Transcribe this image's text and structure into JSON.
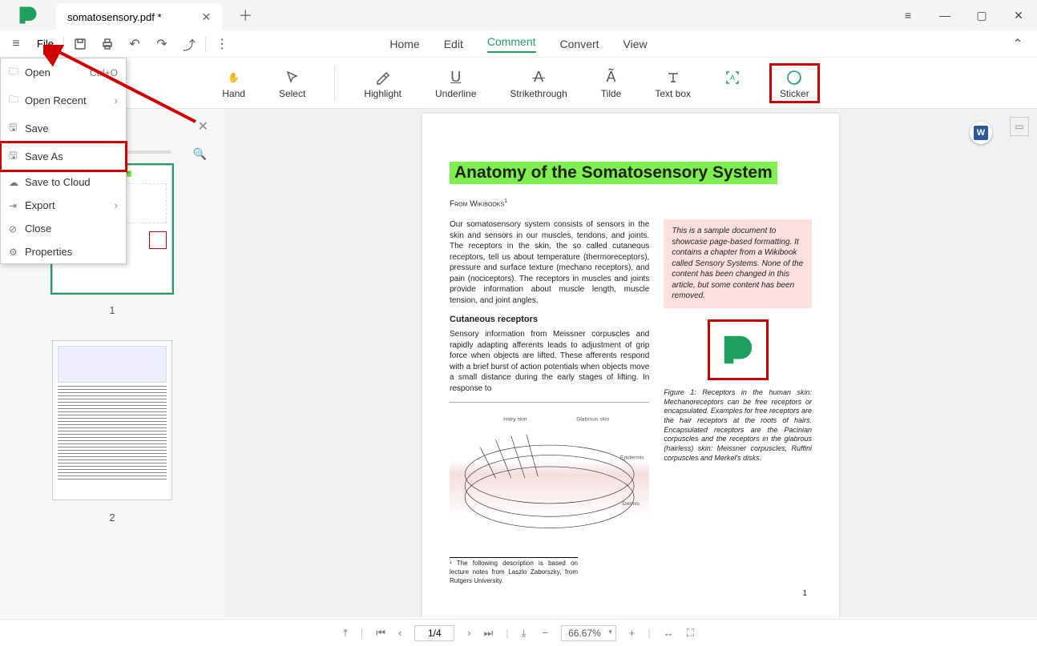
{
  "tab": {
    "title": "somatosensory.pdf *"
  },
  "file_label": "File",
  "ribbon_tabs": {
    "home": "Home",
    "edit": "Edit",
    "comment": "Comment",
    "convert": "Convert",
    "view": "View"
  },
  "tools": {
    "hand": "Hand",
    "select": "Select",
    "highlight": "Highlight",
    "underline": "Underline",
    "strikethrough": "Strikethrough",
    "tilde": "Tilde",
    "textbox": "Text box",
    "sticker": "Sticker"
  },
  "file_menu": {
    "open": {
      "label": "Open",
      "shortcut": "Ctrl+O"
    },
    "open_recent": {
      "label": "Open Recent"
    },
    "save": {
      "label": "Save"
    },
    "save_as": {
      "label": "Save As"
    },
    "save_cloud": {
      "label": "Save to Cloud"
    },
    "export": {
      "label": "Export"
    },
    "close": {
      "label": "Close"
    },
    "properties": {
      "label": "Properties"
    }
  },
  "thumbs": {
    "p1": "1",
    "p2": "2"
  },
  "doc": {
    "title": "Anatomy of the Somatosensory System",
    "source": "From Wikibooks",
    "para1": "Our somatosensory system consists of sensors in the skin and sensors in our muscles, tendons, and joints. The receptors in the skin, the so called cutaneous receptors, tell us about temperature (thermoreceptors), pressure and surface texture (mechano receptors), and pain (nociceptors). The receptors in muscles and joints provide information about muscle length, muscle tension, and joint angles.",
    "callout": "This is a sample document to showcase page-based formatting. It contains a chapter from a Wikibook called Sensory Systems. None of the content has been changed in this article, but some content has been removed.",
    "subhead": "Cutaneous receptors",
    "para2": "Sensory information from Meissner corpuscles and rapidly adapting afferents leads to adjustment of grip force when objects are lifted. These afferents respond with a brief burst of action potentials when objects move a small distance during the early stages of lifting. In response to",
    "figcap": "Figure 1:  Receptors in the human skin: Mechanoreceptors can be free receptors or encapsulated. Examples for free receptors are the hair receptors at the roots of hairs. Encapsulated receptors are the Pacinian corpuscles and the receptors in the glabrous (hairless) skin: Meissner corpuscles, Ruffini corpuscles and Merkel's disks.",
    "footnote": "¹ The following description is based on lecture notes from Laszlo Zaborszky, from Rutgers University.",
    "pagenum": "1"
  },
  "bottom": {
    "page": "1/4",
    "zoom": "66.67%"
  }
}
